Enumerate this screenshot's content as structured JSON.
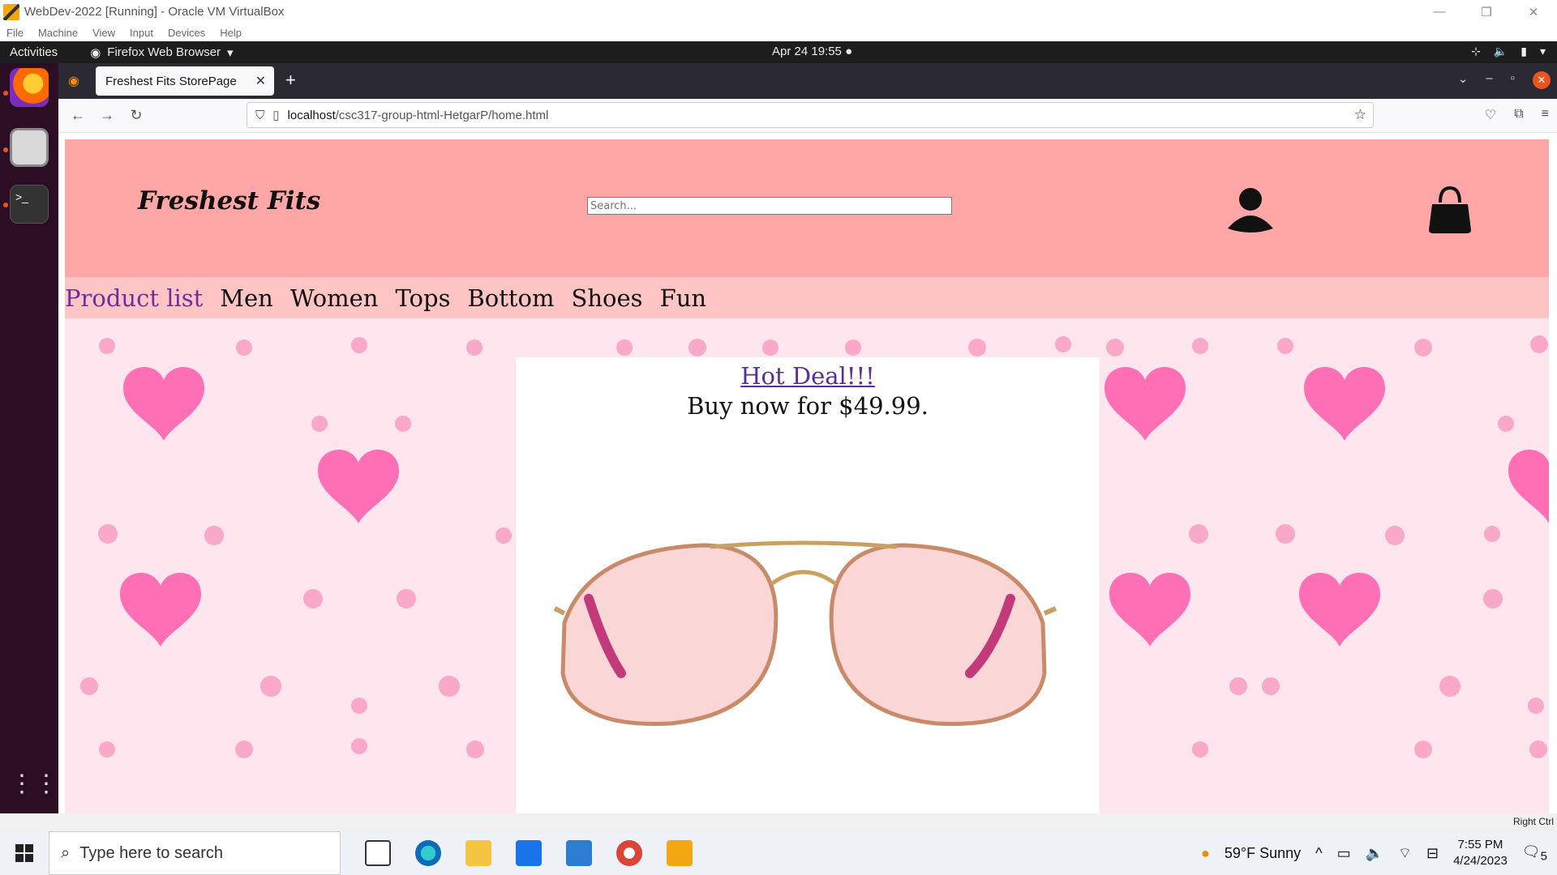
{
  "vbox": {
    "title": "WebDev-2022 [Running] - Oracle VM VirtualBox",
    "menu": [
      "File",
      "Machine",
      "View",
      "Input",
      "Devices",
      "Help"
    ],
    "status_hostkey": "Right Ctrl"
  },
  "gnome": {
    "activities": "Activities",
    "app_name": "Firefox Web Browser",
    "clock": "Apr 24  19:55"
  },
  "browser": {
    "tab_title": "Freshest Fits StorePage",
    "url_host": "localhost",
    "url_path": "/csc317-group-html-HetgarP/home.html"
  },
  "site": {
    "brand": "Freshest Fits",
    "search_placeholder": "Search...",
    "nav": [
      "Product list",
      "Men",
      "Women",
      "Tops",
      "Bottom",
      "Shoes",
      "Fun"
    ],
    "deal_link": "Hot Deal!!!",
    "deal_text": "Buy now for $49.99.",
    "colors": {
      "header": "#ffa6a6",
      "nav": "#ffc4c4",
      "hero": "#ffe6ee",
      "hearts": "#ff6fb5",
      "dots": "#f9a8c8"
    }
  },
  "taskbar": {
    "search_placeholder": "Type here to search",
    "weather": "59°F  Sunny",
    "time": "7:55 PM",
    "date": "4/24/2023",
    "notifications": "5"
  }
}
